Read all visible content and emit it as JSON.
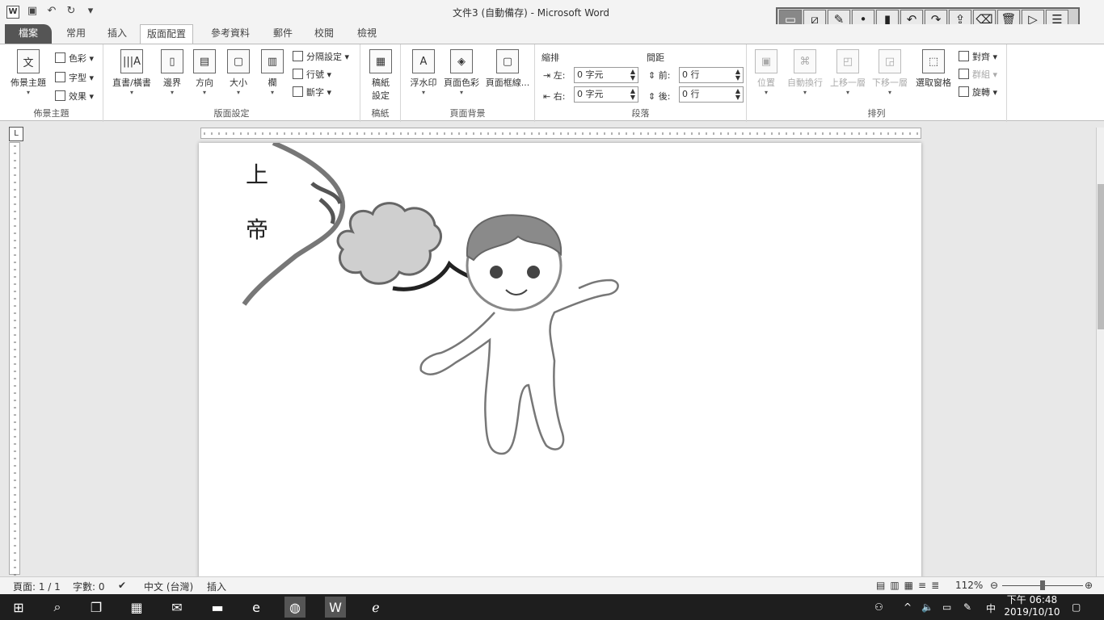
{
  "window": {
    "title": "文件3 (自動備存) - Microsoft Word",
    "app_icon": "W"
  },
  "qat": {
    "icons": [
      "save-icon",
      "undo-icon",
      "redo-icon",
      "customize-icon"
    ]
  },
  "tabs": [
    "檔案",
    "常用",
    "插入",
    "版面配置",
    "參考資料",
    "郵件",
    "校閱",
    "檢視"
  ],
  "ribbon": {
    "themes": {
      "label": "佈景主題",
      "button": "佈景主題",
      "colors": "色彩",
      "fonts": "字型",
      "effects": "效果"
    },
    "page_setup": {
      "label": "版面設定",
      "text_direction": "直書/橫書",
      "margins": "邊界",
      "orientation": "方向",
      "size": "大小",
      "columns": "欄",
      "breaks": "分隔設定",
      "line_numbers": "行號",
      "hyphenation": "斷字"
    },
    "manuscript": {
      "label": "稿紙",
      "button_line1": "稿紙",
      "button_line2": "設定"
    },
    "page_background": {
      "label": "頁面背景",
      "watermark": "浮水印",
      "page_color": "頁面色彩",
      "page_borders": "頁面框線..."
    },
    "paragraph": {
      "label": "段落",
      "indent_heading": "縮排",
      "left_label": "左:",
      "left_value": "0 字元",
      "right_label": "右:",
      "right_value": "0 字元",
      "spacing_heading": "間距",
      "before_label": "前:",
      "before_value": "0 行",
      "after_label": "後:",
      "after_value": "0 行"
    },
    "arrange": {
      "label": "排列",
      "position": "位置",
      "wrap_text": "自動換行",
      "bring_forward": "上移一層",
      "send_backward": "下移一層",
      "selection_pane": "選取窗格",
      "align": "對齊",
      "group": "群組",
      "rotate": "旋轉"
    }
  },
  "document": {
    "text": [
      "上",
      "帝"
    ]
  },
  "status": {
    "page": "頁面: 1 / 1",
    "words": "字數: 0",
    "language": "中文 (台灣)",
    "mode": "插入",
    "zoom": "112%",
    "zoom_level_percent": 112
  },
  "taskbar": {
    "time": "下午 06:48",
    "date": "2019/10/10",
    "ime": "中"
  },
  "ink_toolbar": {
    "icons": [
      "screen-capture-icon",
      "pen-box-icon",
      "brush-icon",
      "dot-icon",
      "highlighter-icon",
      "undo-icon",
      "redo-icon",
      "upload-icon",
      "eraser-icon",
      "trash-icon",
      "play-icon",
      "menu-icon"
    ]
  }
}
